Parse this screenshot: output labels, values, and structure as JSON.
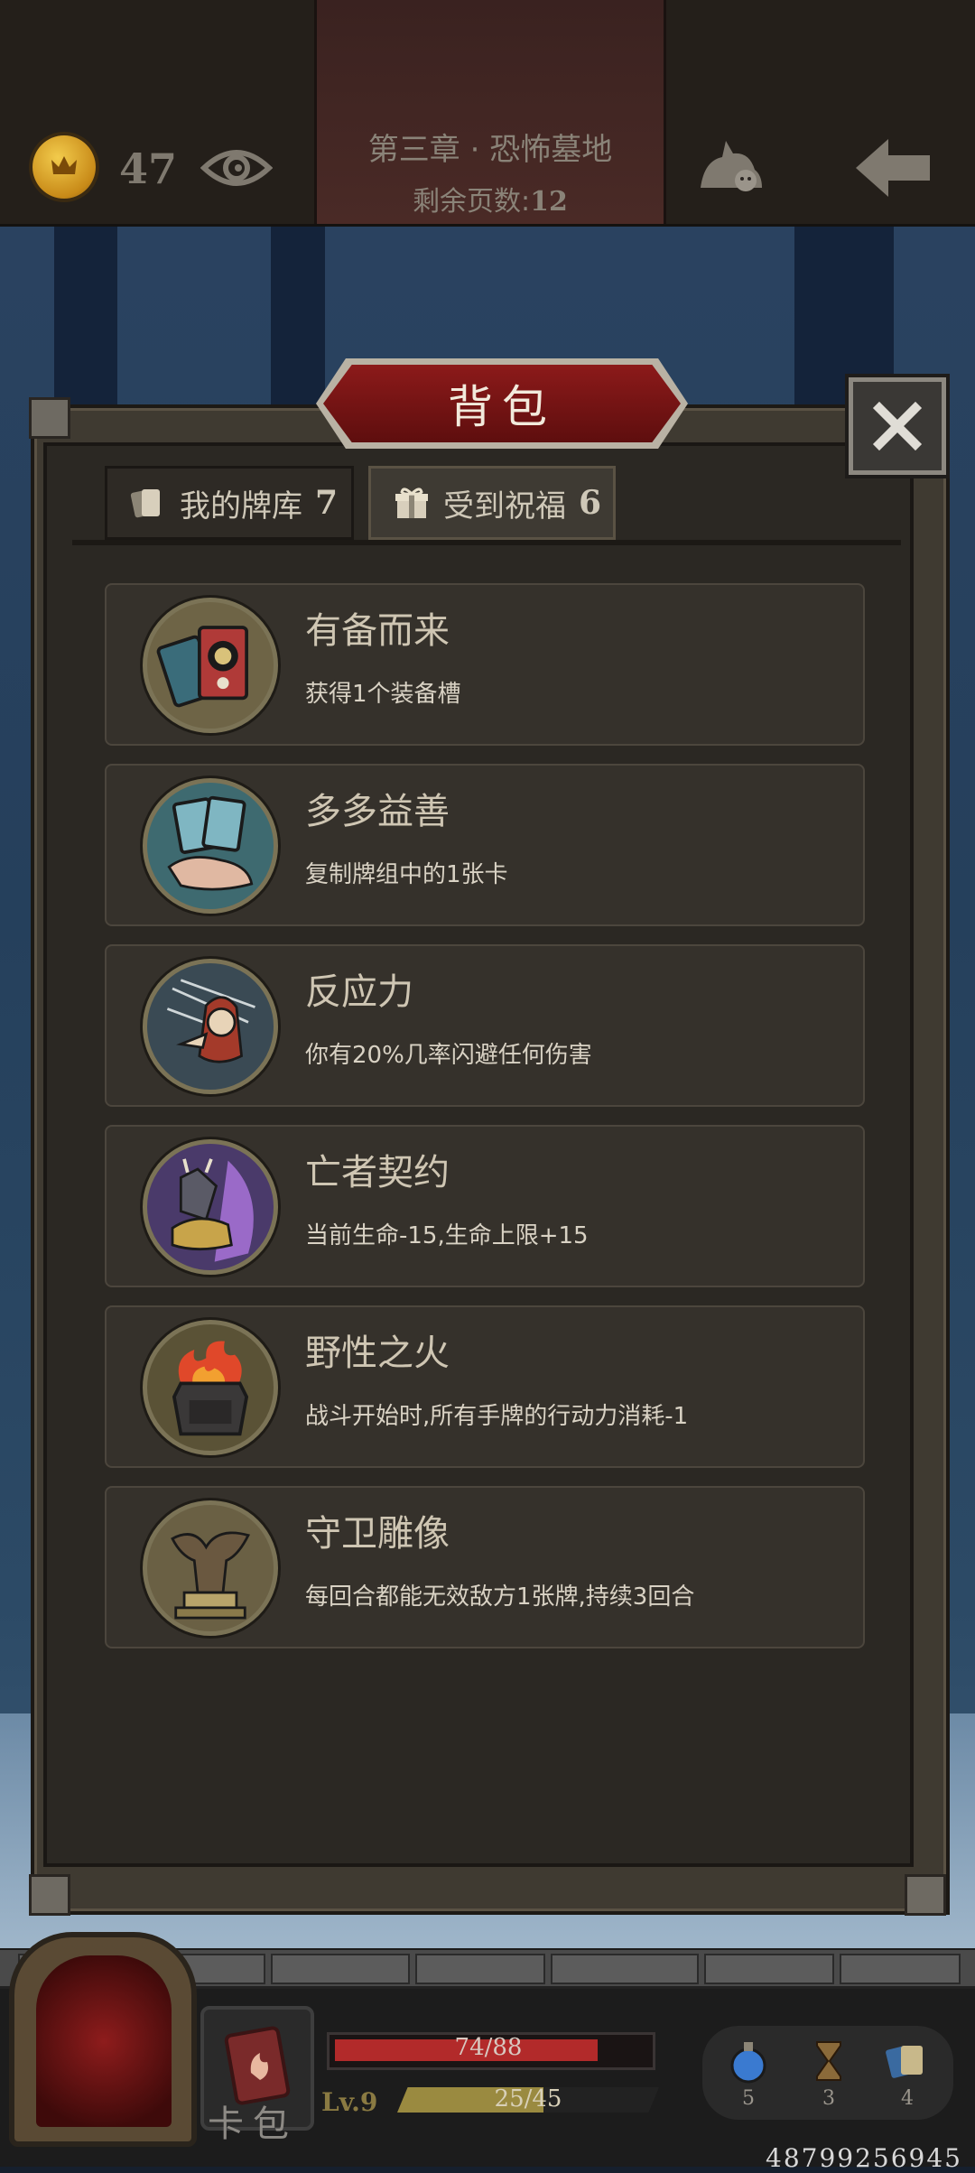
{
  "header": {
    "coin_count": "47",
    "chapter_title": "第三章 · 恐怖墓地",
    "pages_label": "剩余页数:",
    "pages_value": "12"
  },
  "panel": {
    "title": "背包",
    "tabs": [
      {
        "label": "我的牌库",
        "count": "7",
        "active": false
      },
      {
        "label": "受到祝福",
        "count": "6",
        "active": true
      }
    ],
    "items": [
      {
        "name": "有备而来",
        "desc": "获得1个装备槽",
        "icon": "cards-icon"
      },
      {
        "name": "多多益善",
        "desc": "复制牌组中的1张卡",
        "icon": "hand-cards-icon"
      },
      {
        "name": "反应力",
        "desc": "你有20%几率闪避任何伤害",
        "icon": "dodge-icon"
      },
      {
        "name": "亡者契约",
        "desc": "当前生命-15,生命上限+15",
        "icon": "undead-pact-icon"
      },
      {
        "name": "野性之火",
        "desc": "战斗开始时,所有手牌的行动力消耗-1",
        "icon": "fire-altar-icon"
      },
      {
        "name": "守卫雕像",
        "desc": "每回合都能无效敌方1张牌,持续3回合",
        "icon": "statue-icon"
      }
    ]
  },
  "footer": {
    "card_bag_label": "卡包",
    "hp_text": "74/88",
    "hp_fraction": 0.84,
    "level": "Lv.9",
    "xp_text": "25/45",
    "xp_fraction": 0.56,
    "potion_count": "5",
    "hourglass_count": "3",
    "cards_count": "4",
    "user_id": "48799256945"
  },
  "colors": {
    "accent_red": "#8c1a1a",
    "coin_gold": "#e0a82a",
    "hp_red": "#b22a2a"
  }
}
